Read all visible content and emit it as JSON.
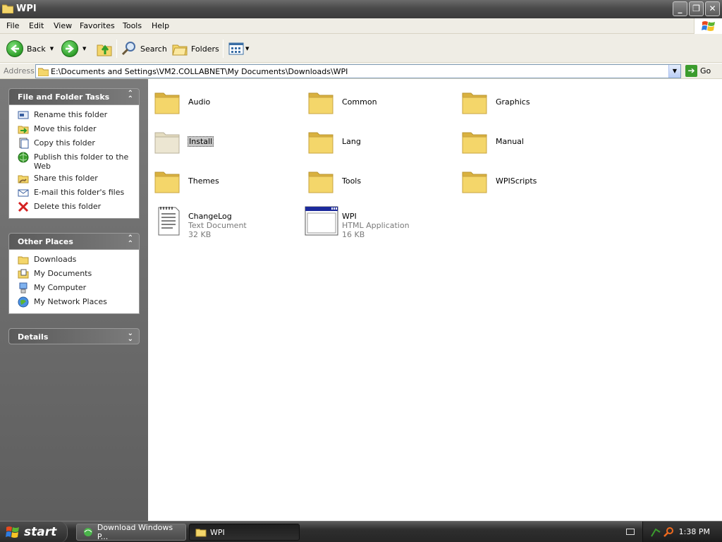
{
  "window": {
    "title": "WPI"
  },
  "menu": {
    "items": [
      "File",
      "Edit",
      "View",
      "Favorites",
      "Tools",
      "Help"
    ]
  },
  "toolbar": {
    "back_label": "Back",
    "search_label": "Search",
    "folders_label": "Folders"
  },
  "address": {
    "label": "Address",
    "path": "E:\\Documents and Settings\\VM2.COLLABNET\\My Documents\\Downloads\\WPI",
    "go_label": "Go"
  },
  "tasks_panel": {
    "title": "File and Folder Tasks",
    "items": [
      {
        "label": "Rename this folder",
        "icon": "rename-icon"
      },
      {
        "label": "Move this folder",
        "icon": "move-icon"
      },
      {
        "label": "Copy this folder",
        "icon": "copy-icon"
      },
      {
        "label": "Publish this folder to the Web",
        "icon": "publish-web-icon"
      },
      {
        "label": "Share this folder",
        "icon": "share-icon"
      },
      {
        "label": "E-mail this folder's files",
        "icon": "email-icon"
      },
      {
        "label": "Delete this folder",
        "icon": "delete-icon"
      }
    ]
  },
  "places_panel": {
    "title": "Other Places",
    "items": [
      {
        "label": "Downloads",
        "icon": "folder-icon"
      },
      {
        "label": "My Documents",
        "icon": "my-documents-icon"
      },
      {
        "label": "My Computer",
        "icon": "my-computer-icon"
      },
      {
        "label": "My Network Places",
        "icon": "network-places-icon"
      }
    ]
  },
  "details_panel": {
    "title": "Details"
  },
  "files": {
    "folders": [
      {
        "name": "Audio"
      },
      {
        "name": "Common"
      },
      {
        "name": "Graphics"
      },
      {
        "name": "Install",
        "selected": true
      },
      {
        "name": "Lang"
      },
      {
        "name": "Manual"
      },
      {
        "name": "Themes"
      },
      {
        "name": "Tools"
      },
      {
        "name": "WPIScripts"
      }
    ],
    "documents": [
      {
        "name": "ChangeLog",
        "type": "Text Document",
        "size": "32 KB",
        "icon": "text-document-icon"
      },
      {
        "name": "WPI",
        "type": "HTML Application",
        "size": "16 KB",
        "icon": "html-application-icon"
      }
    ]
  },
  "taskbar": {
    "start_label": "start",
    "tasks": [
      {
        "label": "Download Windows P...",
        "active": false
      },
      {
        "label": "WPI",
        "active": true
      }
    ],
    "clock": "1:38 PM"
  },
  "colors": {
    "folder": "#f4d66a",
    "folder_dark": "#d9b13f",
    "selection": "#c8c8c8",
    "link_green": "#3b9c2d"
  }
}
